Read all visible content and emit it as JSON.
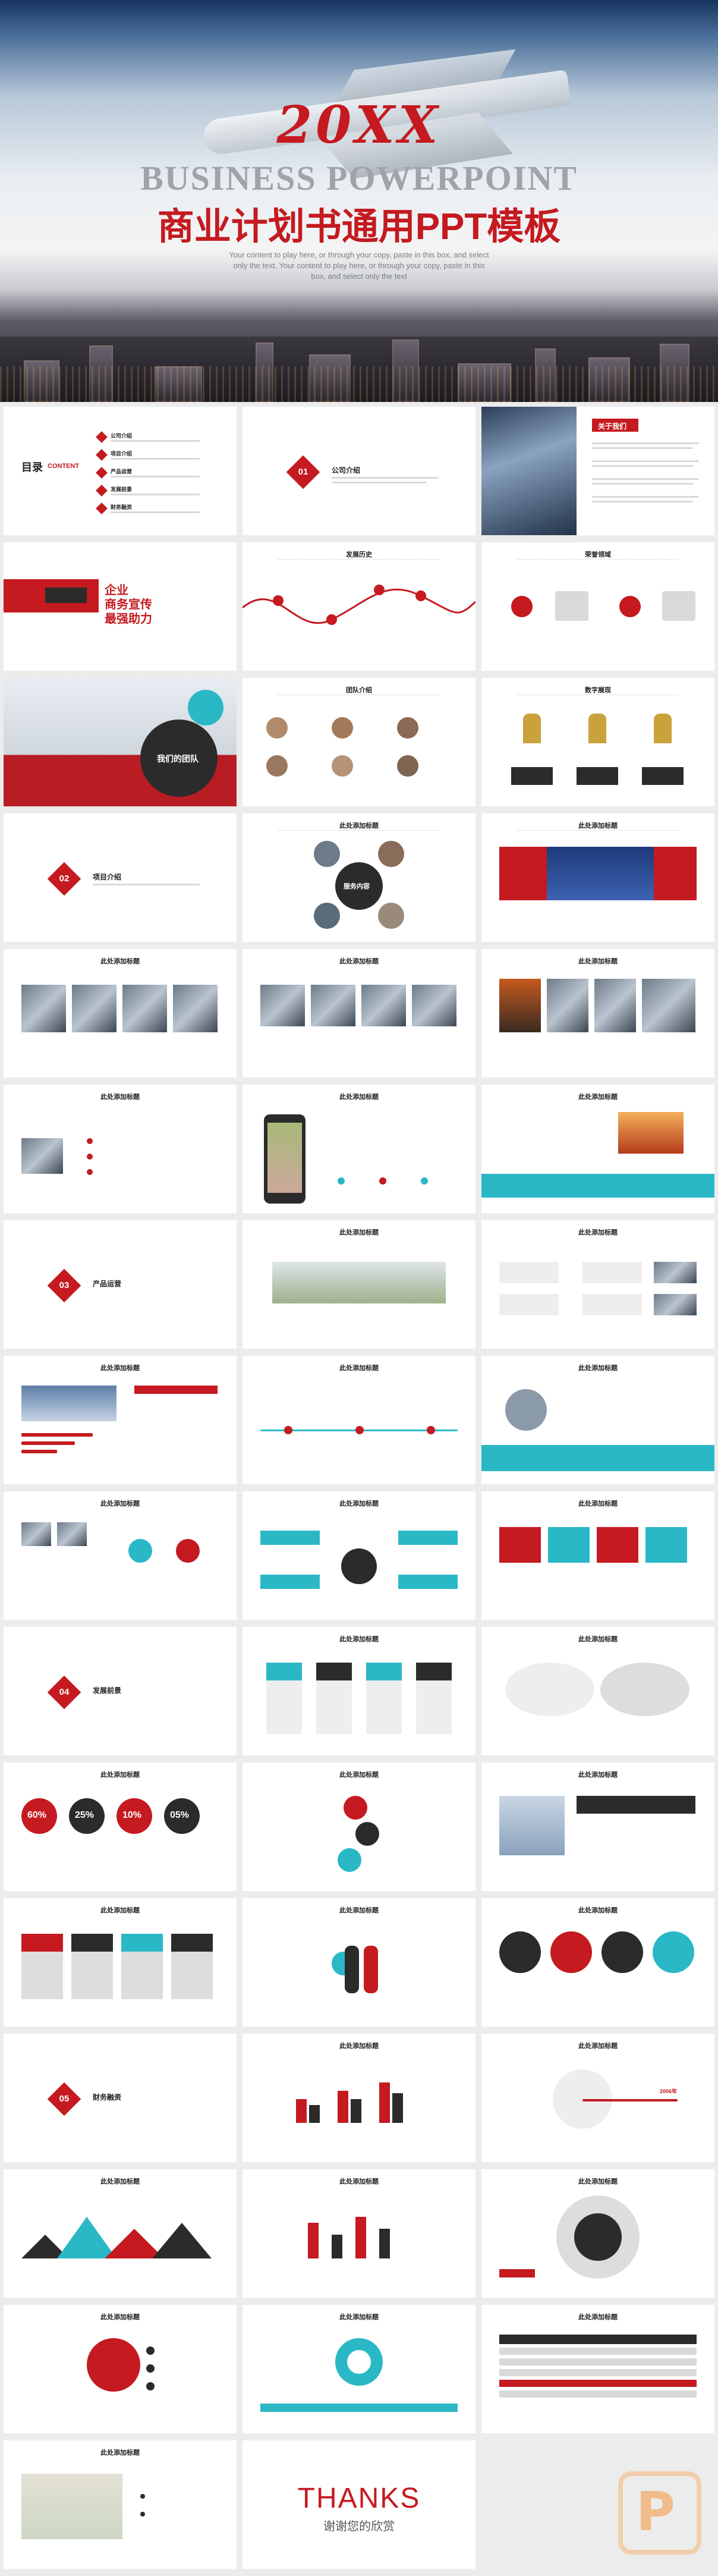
{
  "cover": {
    "year": "20XX",
    "title_en": "BUSINESS POWERPOINT",
    "title_cn": "商业计划书通用PPT模板",
    "subtitle": "Your content to play here, or through your copy, paste in this box, and select only the text. Your content to play here, or through your copy, paste in this box, and select only the text"
  },
  "slides": {
    "toc_title": "目录",
    "toc_en": "CONTENT",
    "toc_items": [
      "公司介绍",
      "项目介绍",
      "产品运营",
      "发展前景",
      "财务融资"
    ],
    "section1_num": "01",
    "section1_title": "公司介绍",
    "about_title": "关于我们",
    "enterprise_line1": "企业",
    "enterprise_line2": "商务宣传",
    "enterprise_line3": "最强助力",
    "history_title": "发展历史",
    "honor_title": "荣誉领域",
    "team_title": "我们的团队",
    "team_intro": "团队介绍",
    "data_title": "数字展现",
    "section2_num": "02",
    "section2_title": "项目介绍",
    "add_title": "此处添加标题",
    "service": "服务内容",
    "section3_num": "03",
    "section3_title": "产品运营",
    "section4_num": "04",
    "section4_title": "发展前景",
    "section5_num": "05",
    "section5_title": "财务融资",
    "pct": [
      "60%",
      "25%",
      "10%",
      "05%"
    ],
    "year_label": "2006年",
    "thanks_en": "THANKS",
    "thanks_cn": "谢谢您的欣赏"
  }
}
